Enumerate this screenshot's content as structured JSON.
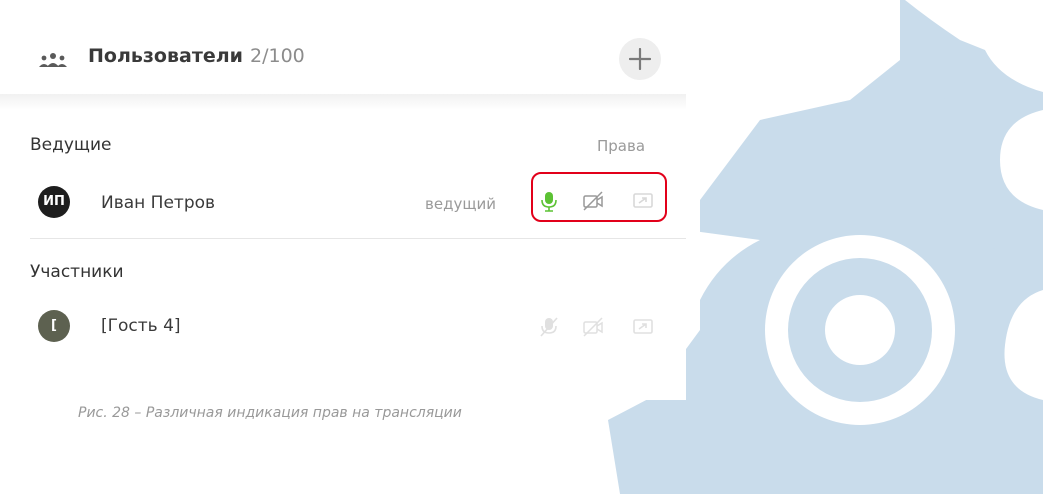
{
  "header": {
    "title": "Пользователи",
    "count": "2/100",
    "users_icon": "users-group-icon",
    "add_icon": "plus-icon"
  },
  "hosts": {
    "title": "Ведущие",
    "rights_label": "Права",
    "members": [
      {
        "initials": "ИП",
        "name": "Иван Петров",
        "role": "ведущий",
        "avatar_color": "#1e1e1e",
        "mic": "on",
        "camera": "off",
        "screen": "off"
      }
    ]
  },
  "participants": {
    "title": "Участники",
    "members": [
      {
        "initials": "[",
        "name": "[Гость 4]",
        "avatar_color": "#5d6150",
        "mic": "disabled",
        "camera": "disabled",
        "screen": "disabled"
      }
    ]
  },
  "caption": "Рис. 28 – Различная индикация прав на трансляции",
  "colors": {
    "mic_active": "#5cc234",
    "icon_inactive": "#d8d8d8",
    "icon_muted": "#999999",
    "highlight": "#e2001a",
    "decor": "#c9dceb"
  }
}
